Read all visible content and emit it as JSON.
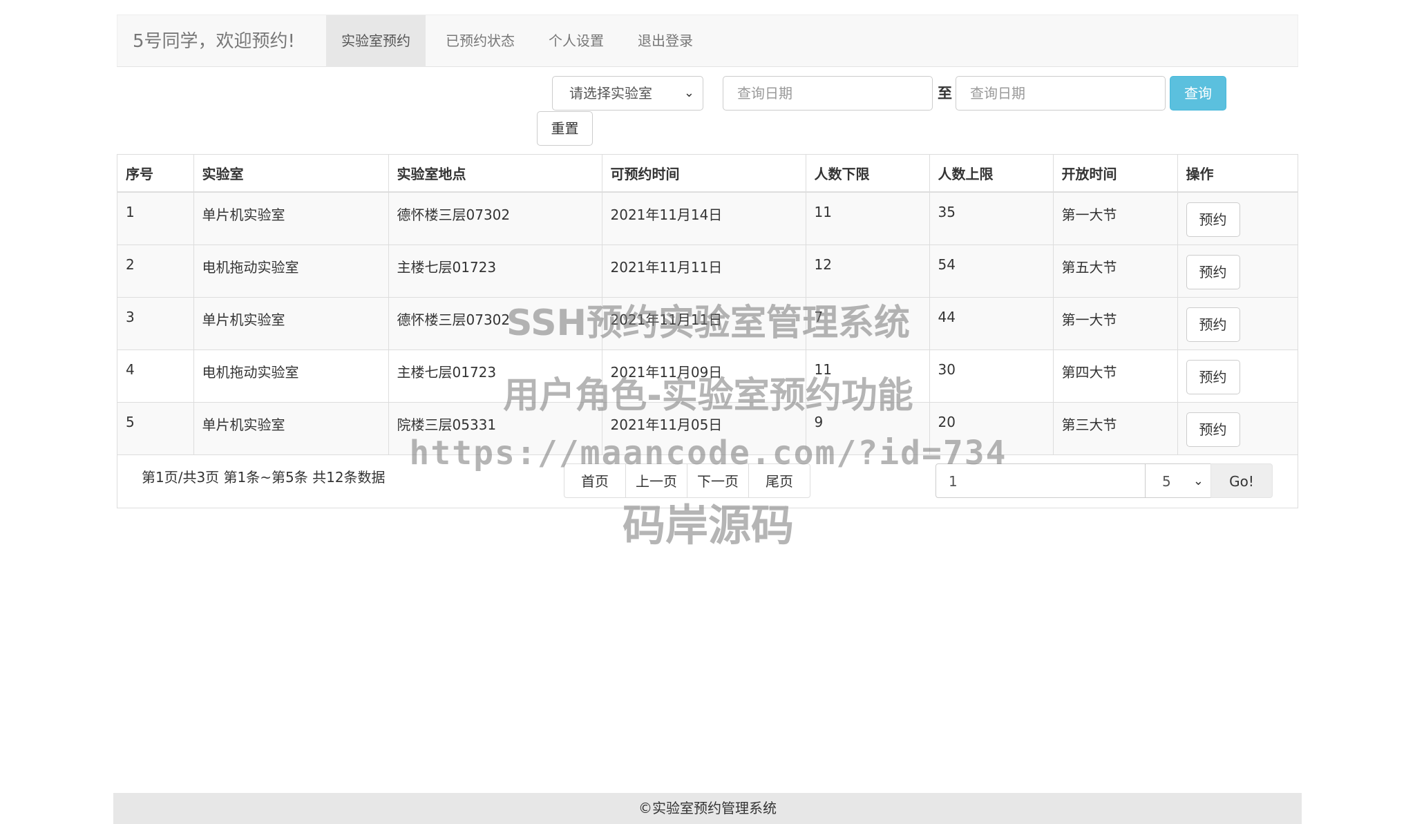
{
  "nav": {
    "brand": "5号同学，欢迎预约!",
    "items": [
      {
        "label": "实验室预约",
        "active": true
      },
      {
        "label": "已预约状态",
        "active": false
      },
      {
        "label": "个人设置",
        "active": false
      },
      {
        "label": "退出登录",
        "active": false
      }
    ]
  },
  "search": {
    "lab_select": "请选择实验室",
    "date_from_placeholder": "查询日期",
    "to_label": "至",
    "date_to_placeholder": "查询日期",
    "query_label": "查询",
    "reset_label": "重置"
  },
  "table": {
    "headers": [
      "序号",
      "实验室",
      "实验室地点",
      "可预约时间",
      "人数下限",
      "人数上限",
      "开放时间",
      "操作"
    ],
    "rows": [
      {
        "no": "1",
        "lab": "单片机实验室",
        "location": "德怀楼三层07302",
        "date": "2021年11月14日",
        "min": "11",
        "max": "35",
        "slot": "第一大节",
        "action": "预约"
      },
      {
        "no": "2",
        "lab": "电机拖动实验室",
        "location": "主楼七层01723",
        "date": "2021年11月11日",
        "min": "12",
        "max": "54",
        "slot": "第五大节",
        "action": "预约"
      },
      {
        "no": "3",
        "lab": "单片机实验室",
        "location": "德怀楼三层07302",
        "date": "2021年11月11日",
        "min": "7",
        "max": "44",
        "slot": "第一大节",
        "action": "预约"
      },
      {
        "no": "4",
        "lab": "电机拖动实验室",
        "location": "主楼七层01723",
        "date": "2021年11月09日",
        "min": "11",
        "max": "30",
        "slot": "第四大节",
        "action": "预约"
      },
      {
        "no": "5",
        "lab": "单片机实验室",
        "location": "院楼三层05331",
        "date": "2021年11月05日",
        "min": "9",
        "max": "20",
        "slot": "第三大节",
        "action": "预约"
      }
    ]
  },
  "pager": {
    "info": "第1页/共3页  第1条~第5条  共12条数据",
    "first": "首页",
    "prev": "上一页",
    "next": "下一页",
    "last": "尾页",
    "page_input": "1",
    "page_size": "5",
    "go": "Go!"
  },
  "watermark": {
    "line1": "SSH预约实验室管理系统",
    "line2": "用户角色-实验室预约功能",
    "line3": "https://maancode.com/?id=734",
    "line4": "码岸源码"
  },
  "footer": {
    "text": "©实验室预约管理系统"
  }
}
